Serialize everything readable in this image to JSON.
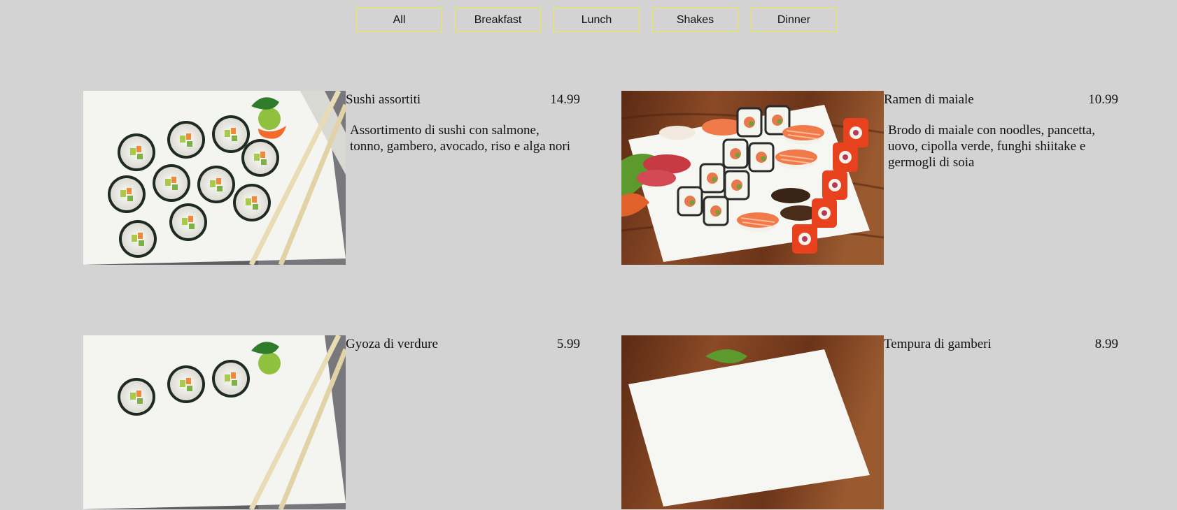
{
  "filters": [
    "All",
    "Breakfast",
    "Lunch",
    "Shakes",
    "Dinner"
  ],
  "menu": [
    {
      "name": "Sushi assortiti",
      "price": "14.99",
      "description": "Assortimento di sushi con salmone, tonno, gambero, avocado, riso e alga nori",
      "image": "sushi-rolls-photo"
    },
    {
      "name": "Ramen di maiale",
      "price": "10.99",
      "description": "Brodo di maiale con noodles, pancetta, uovo, cipolla verde, funghi shiitake e germogli di soia",
      "image": "sushi-platter-photo"
    },
    {
      "name": "Gyoza di verdure",
      "price": "5.99",
      "description": "",
      "image": "sushi-rolls-photo"
    },
    {
      "name": "Tempura di gamberi",
      "price": "8.99",
      "description": "",
      "image": "sushi-platter-photo"
    }
  ]
}
